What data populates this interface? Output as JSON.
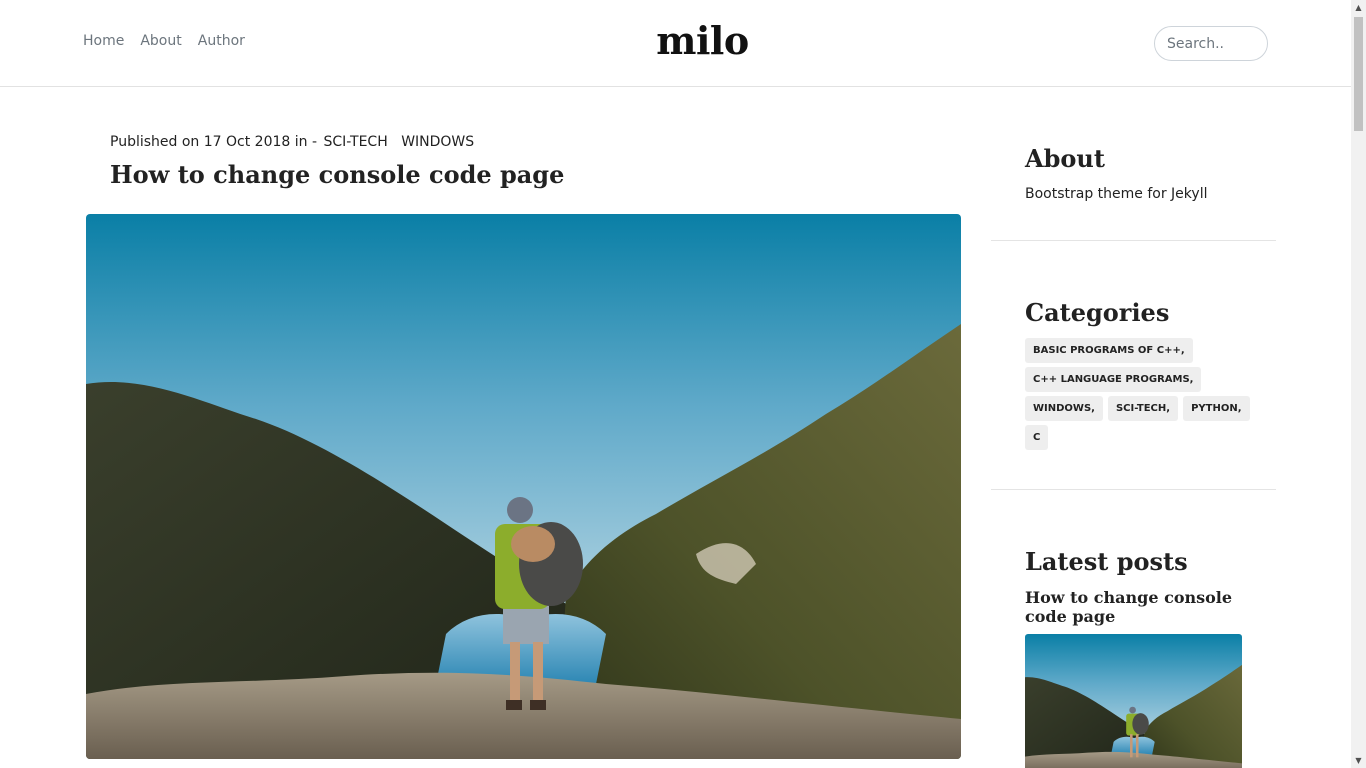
{
  "header": {
    "nav": [
      {
        "label": "Home"
      },
      {
        "label": "About"
      },
      {
        "label": "Author"
      }
    ],
    "brand": "milo",
    "search_placeholder": "Search.."
  },
  "post": {
    "meta_prefix": "Published on 17 Oct 2018 in -",
    "categories": [
      "SCI-TECH",
      "WINDOWS"
    ],
    "title": "How to change console code page"
  },
  "sidebar": {
    "about_heading": "About",
    "about_text": "Bootstrap theme for Jekyll",
    "categories_heading": "Categories",
    "tags": [
      "BASIC PROGRAMS OF C++,",
      "C++ LANGUAGE PROGRAMS,",
      "WINDOWS,",
      "SCI-TECH,",
      "PYTHON,",
      "C"
    ],
    "latest_heading": "Latest posts",
    "latest_post_title": "How to change console code page"
  },
  "scrollbar": {
    "up_icon": "arrow-up-icon",
    "down_icon": "arrow-down-icon"
  }
}
